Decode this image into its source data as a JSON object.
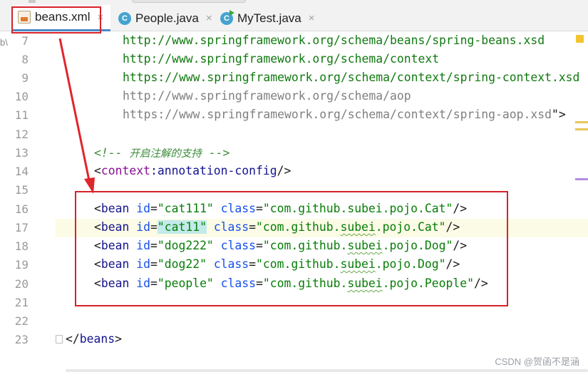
{
  "tabs": [
    {
      "label": "beans.xml",
      "icon": "xml-file-icon",
      "active": true
    },
    {
      "label": "People.java",
      "icon": "java-class-icon",
      "active": false
    },
    {
      "label": "MyTest.java",
      "icon": "java-test-class-icon",
      "active": false
    }
  ],
  "tab_icon_letter": "C",
  "close_glyph": "×",
  "gutter_fragment": "b\\",
  "line_numbers": [
    "7",
    "8",
    "9",
    "10",
    "11",
    "12",
    "13",
    "14",
    "15",
    "16",
    "17",
    "18",
    "19",
    "20",
    "21",
    "22",
    "23"
  ],
  "code": {
    "l7": "http://www.springframework.org/schema/beans/spring-beans.xsd",
    "l8": "http://www.springframework.org/schema/context",
    "l9": "https://www.springframework.org/schema/context/spring-context.xsd",
    "l10": "http://www.springframework.org/schema/aop",
    "l11": "https://www.springframework.org/schema/context/spring-aop.xsd",
    "l11_end": "\">",
    "l13_open": "<!-- ",
    "l13_text": "开启注解的支持",
    "l13_close": " -->",
    "l14_lt": "<",
    "l14_ns": "context",
    "l14_colon": ":",
    "l14_name": "annotation-config",
    "l14_end": "/>",
    "beans": [
      {
        "id_q": "\"cat111\"",
        "cls_q": "\"com.github.",
        "cls_mid": "subei",
        "cls_tail": ".pojo.Cat\"",
        "end": "/>"
      },
      {
        "id_q": "\"cat11\"",
        "cls_q": "\"com.github.",
        "cls_mid": "subei",
        "cls_tail": ".pojo.Cat\"",
        "end": "/>"
      },
      {
        "id_q": "\"dog222\"",
        "cls_q": "\"com.github.",
        "cls_mid": "subei",
        "cls_tail": ".pojo.Dog\"",
        "end": "/>"
      },
      {
        "id_q": "\"dog22\"",
        "cls_q": "\"com.github.",
        "cls_mid": "subei",
        "cls_tail": ".pojo.Dog\"",
        "end": "/>"
      },
      {
        "id_q": "\"people\"",
        "cls_q": "\"com.github.",
        "cls_mid": "subei",
        "cls_tail": ".pojo.People\"",
        "end": "/>"
      }
    ],
    "bean_tag": "bean",
    "attr_id": "id",
    "attr_class": "class",
    "eq": "=",
    "l23_lt": "</",
    "l23_name": "beans",
    "l23_gt": ">"
  },
  "watermark": "CSDN @贺函不是涵",
  "colors": {
    "annotation_red": "#d6222a",
    "active_tab_underline": "#4a88c7",
    "string_green": "#087d08",
    "tag_navy": "#14148f",
    "attr_blue": "#1750eb"
  }
}
